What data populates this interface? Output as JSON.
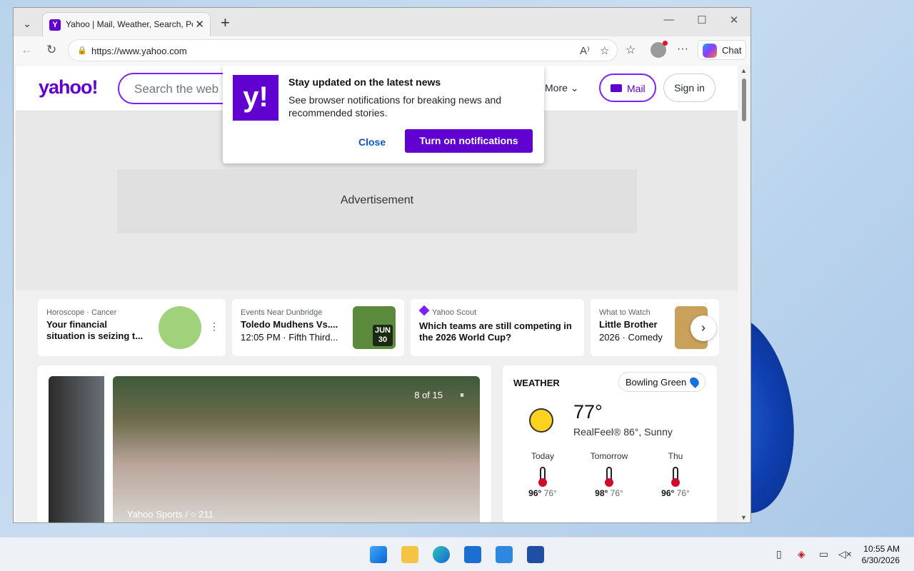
{
  "browser": {
    "tab_title": "Yahoo | Mail, Weather, Search, Poli",
    "url": "https://www.yahoo.com",
    "chat_label": "Chat"
  },
  "yahoo": {
    "logo": "yahoo!",
    "search_placeholder": "Search the web",
    "more_label": "More",
    "mail_label": "Mail",
    "signin_label": "Sign in",
    "ad_label": "Advertisement"
  },
  "popup": {
    "title": "Stay updated on the latest news",
    "body": "See browser notifications for breaking news and recommended stories.",
    "close_label": "Close",
    "turn_on_label": "Turn on notifications"
  },
  "cards": [
    {
      "kicker": "Horoscope · Cancer",
      "title": "Your financial situation is seizing t..."
    },
    {
      "kicker": "Events Near Dunbridge",
      "title": "Toledo Mudhens Vs....",
      "sub": "12:05 PM · Fifth Third...",
      "badge_month": "JUN",
      "badge_day": "30"
    },
    {
      "kicker": "Yahoo Scout",
      "title": "Which teams are still competing in the 2026 World Cup?"
    },
    {
      "kicker": "What to Watch",
      "title": "Little Brother",
      "sub": "2026 · Comedy"
    }
  ],
  "hero": {
    "counter": "8 of 15",
    "source": "Yahoo Sports",
    "comments": "211"
  },
  "weather": {
    "heading": "WEATHER",
    "location": "Bowling Green",
    "temp": "77°",
    "realfeel": "RealFeel® 86°, Sunny",
    "forecast": [
      {
        "day": "Today",
        "high": "96°",
        "low": "76°"
      },
      {
        "day": "Tomorrow",
        "high": "98°",
        "low": "76°"
      },
      {
        "day": "Thu",
        "high": "96°",
        "low": "76°"
      }
    ]
  },
  "taskbar": {
    "time": "10:55 AM",
    "date": "6/30/2026"
  },
  "colors": {
    "yahoo_purple": "#6001d2",
    "link_blue": "#0b57d0"
  }
}
